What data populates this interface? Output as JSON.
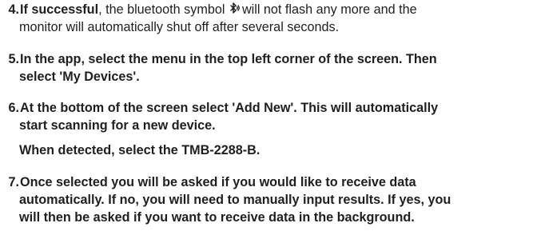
{
  "steps": [
    {
      "number": "4.",
      "lead": "If successful",
      "text_before_icon": ", the bluetooth symbol",
      "icon": "bluetooth-flashing-icon",
      "text_after_icon": "will not flash any more and the",
      "line2": "monitor will automatically shut off after several seconds."
    },
    {
      "number": "5.",
      "line1": "In the app, select the menu in the top left corner of the screen. Then",
      "line2": "select 'My Devices'."
    },
    {
      "number": "6.",
      "line1": "At the bottom of the screen select 'Add New'. This will automatically",
      "line2": "start scanning for a new device.",
      "line3": "When detected, select the TMB-2288-B."
    },
    {
      "number": "7.",
      "line1": "Once selected you will be asked if you would like to receive data",
      "line2": "automatically. If no, you will need to manually input results. If yes, you",
      "line3": "will then be asked if you want to receive data in the background."
    }
  ]
}
